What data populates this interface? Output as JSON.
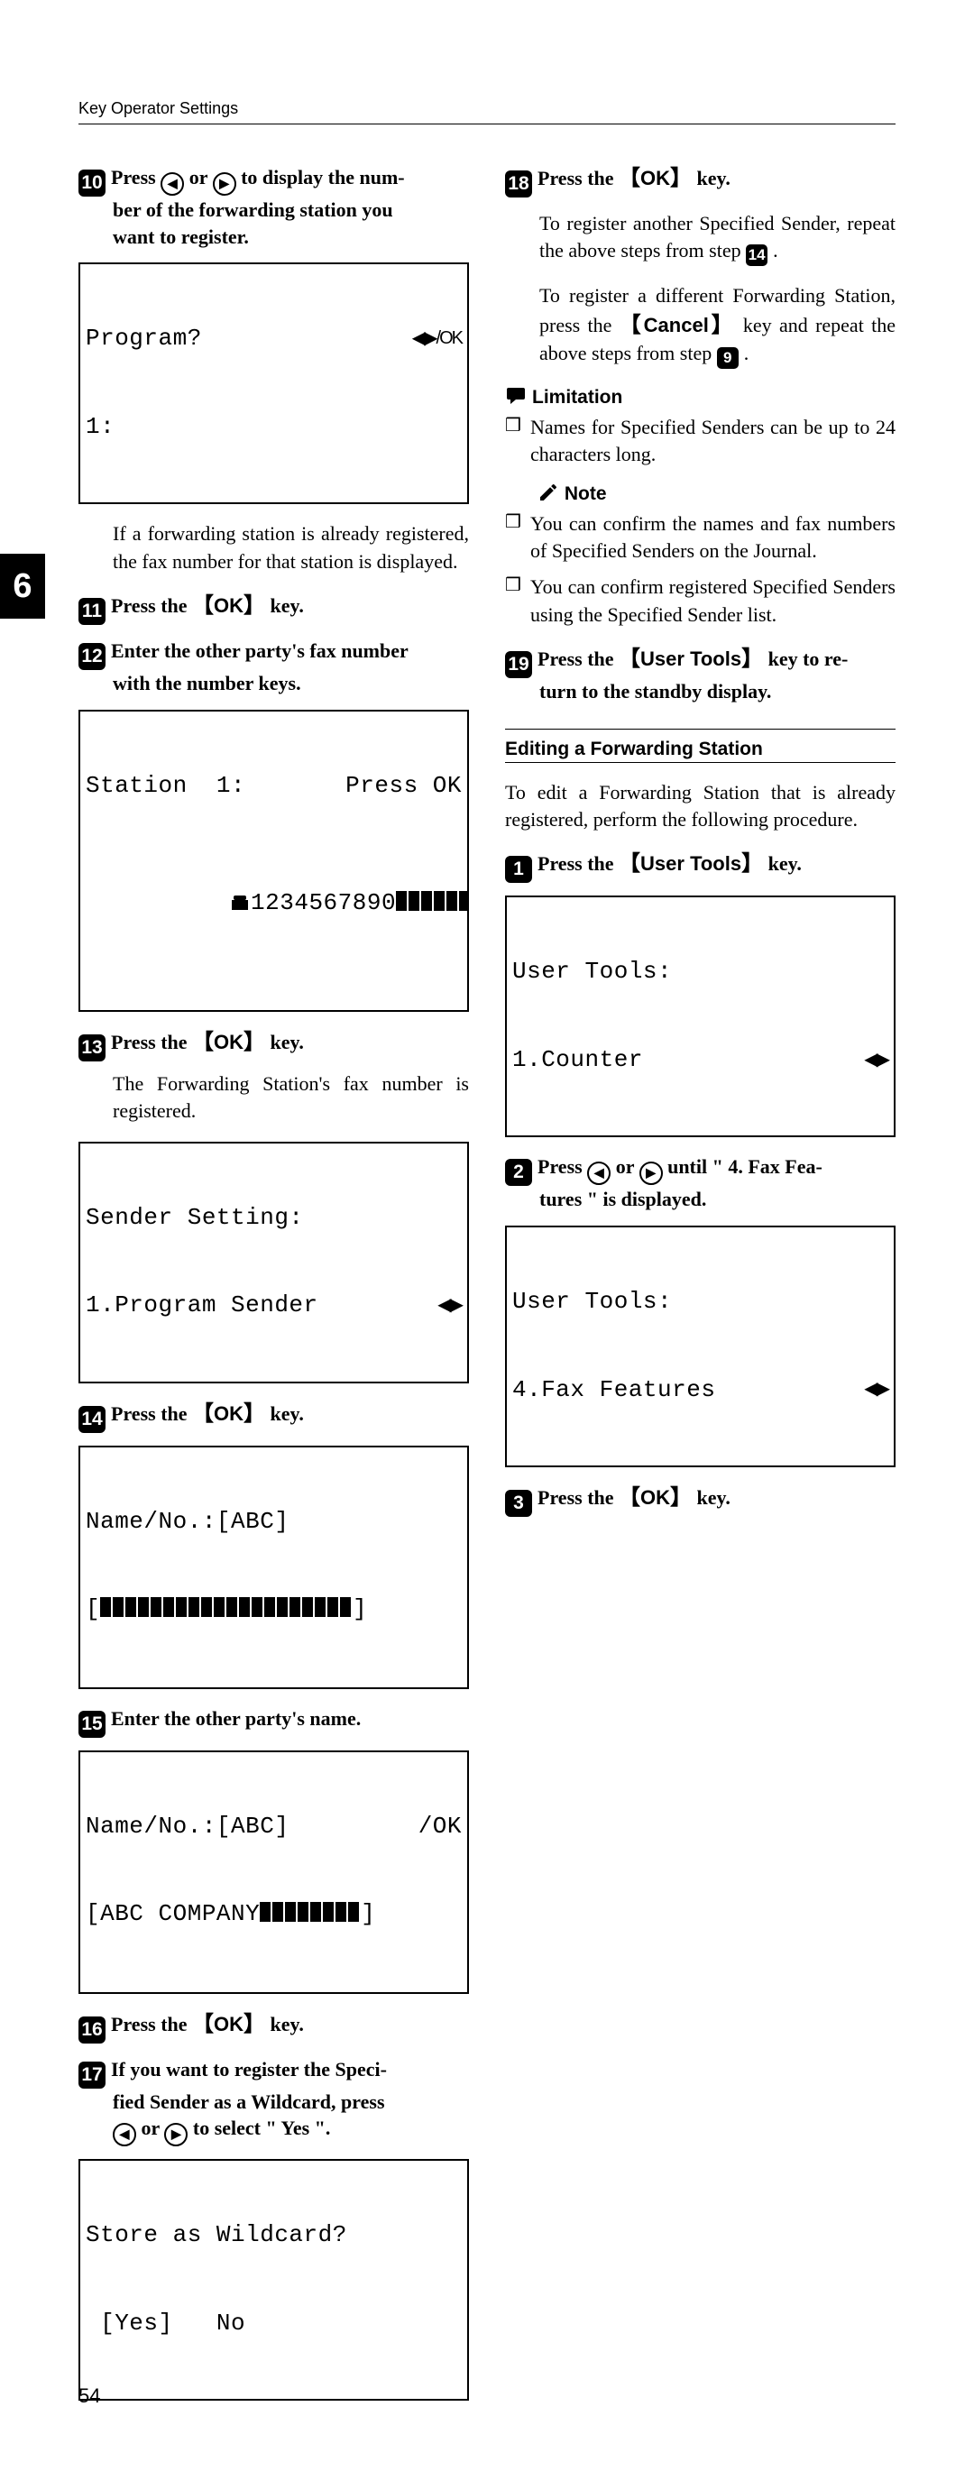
{
  "header": {
    "title": "Key Operator Settings"
  },
  "tab": {
    "number": "6"
  },
  "page_number": "54",
  "keys": {
    "ok": "OK",
    "cancel": "Cancel",
    "user_tools": "User Tools"
  },
  "glyphs": {
    "left_arrow": "◀",
    "right_arrow": "▶",
    "left_right": "◀▶",
    "ok_suffix": "/OK"
  },
  "left": {
    "s10": {
      "num": "10",
      "t1": "Press ",
      "t2": " or ",
      "t3": " to display the num-",
      "line2": "ber of the forwarding station you",
      "line3": "want to register."
    },
    "lcd1": {
      "l1_left": "Program?",
      "l1_right": "◀▶/OK",
      "l2": "1:"
    },
    "after_lcd1": "If a forwarding station is already registered, the fax number for that station is displayed.",
    "s11": {
      "num": "11",
      "t1": "Press the ",
      "t2": " key."
    },
    "s12": {
      "num": "12",
      "line1": "Enter the other party's fax number",
      "line2": "with the number keys."
    },
    "lcd2": {
      "l1_left": "Station  1:",
      "l1_right": "Press OK",
      "l2_prefix": "1234567890"
    },
    "s13": {
      "num": "13",
      "t1": "Press the ",
      "t2": " key."
    },
    "after_s13": "The Forwarding Station's fax number is registered.",
    "lcd3": {
      "l1": "Sender Setting:",
      "l2_left": "1.Program Sender",
      "l2_right": "◀▶"
    },
    "s14": {
      "num": "14",
      "t1": "Press the ",
      "t2": " key."
    },
    "lcd4": {
      "l1": "Name/No.:[ABC]",
      "l2_left": "[",
      "l2_right": "]"
    },
    "s15": {
      "num": "15",
      "text": "Enter the other party's name."
    },
    "lcd5": {
      "l1_left": "Name/No.:[ABC]",
      "l1_right": "/OK",
      "l2_left": "[ABC COMPANY",
      "l2_right": "]"
    },
    "s16": {
      "num": "16",
      "t1": "Press the ",
      "t2": " key."
    },
    "s17": {
      "num": "17",
      "line1": "If you want to register the Speci-",
      "line2": "fied Sender as a Wildcard, press",
      "line3a": "",
      "line3_or": " or ",
      "line3b": " to select \" Yes \"."
    },
    "lcd6": {
      "l1": "Store as Wildcard?",
      "l2": " [Yes]   No"
    }
  },
  "right": {
    "s18": {
      "num": "18",
      "t1": "Press the ",
      "t2": " key."
    },
    "p1": "To register another Specified Sender, repeat the above steps from step ",
    "p1_ref": "14",
    "p1_end": ".",
    "p2a": "To register a different Forwarding Station, press the ",
    "p2b": " key and repeat the above steps from step ",
    "p2_ref": "9",
    "p2_end": ".",
    "limitation_head": "Limitation",
    "limitation_item": "Names for Specified Senders can be up to 24 characters long.",
    "note_head": "Note",
    "note1": "You can confirm the names and fax numbers of Specified Senders on the Journal.",
    "note2": "You can confirm registered Specified Senders using the Specified Sender list.",
    "s19": {
      "num": "19",
      "t1": "Press the ",
      "t2": " key to re-",
      "line2": "turn to the standby display."
    },
    "subsection": "Editing a Forwarding Station",
    "sub_intro": "To edit a Forwarding Station that is already registered, perform the following procedure.",
    "e1": {
      "num": "1",
      "t1": "Press the ",
      "t2": " key."
    },
    "lcdA": {
      "l1": "User Tools:",
      "l2_left": "1.Counter",
      "l2_right": "◀▶"
    },
    "e2": {
      "num": "2",
      "t1": "Press ",
      "t_or": " or ",
      "t2": " until \" 4. Fax Fea-",
      "line2": "tures \" is displayed."
    },
    "lcdB": {
      "l1": "User Tools:",
      "l2_left": "4.Fax Features",
      "l2_right": "◀▶"
    },
    "e3": {
      "num": "3",
      "t1": "Press the ",
      "t2": " key."
    }
  }
}
